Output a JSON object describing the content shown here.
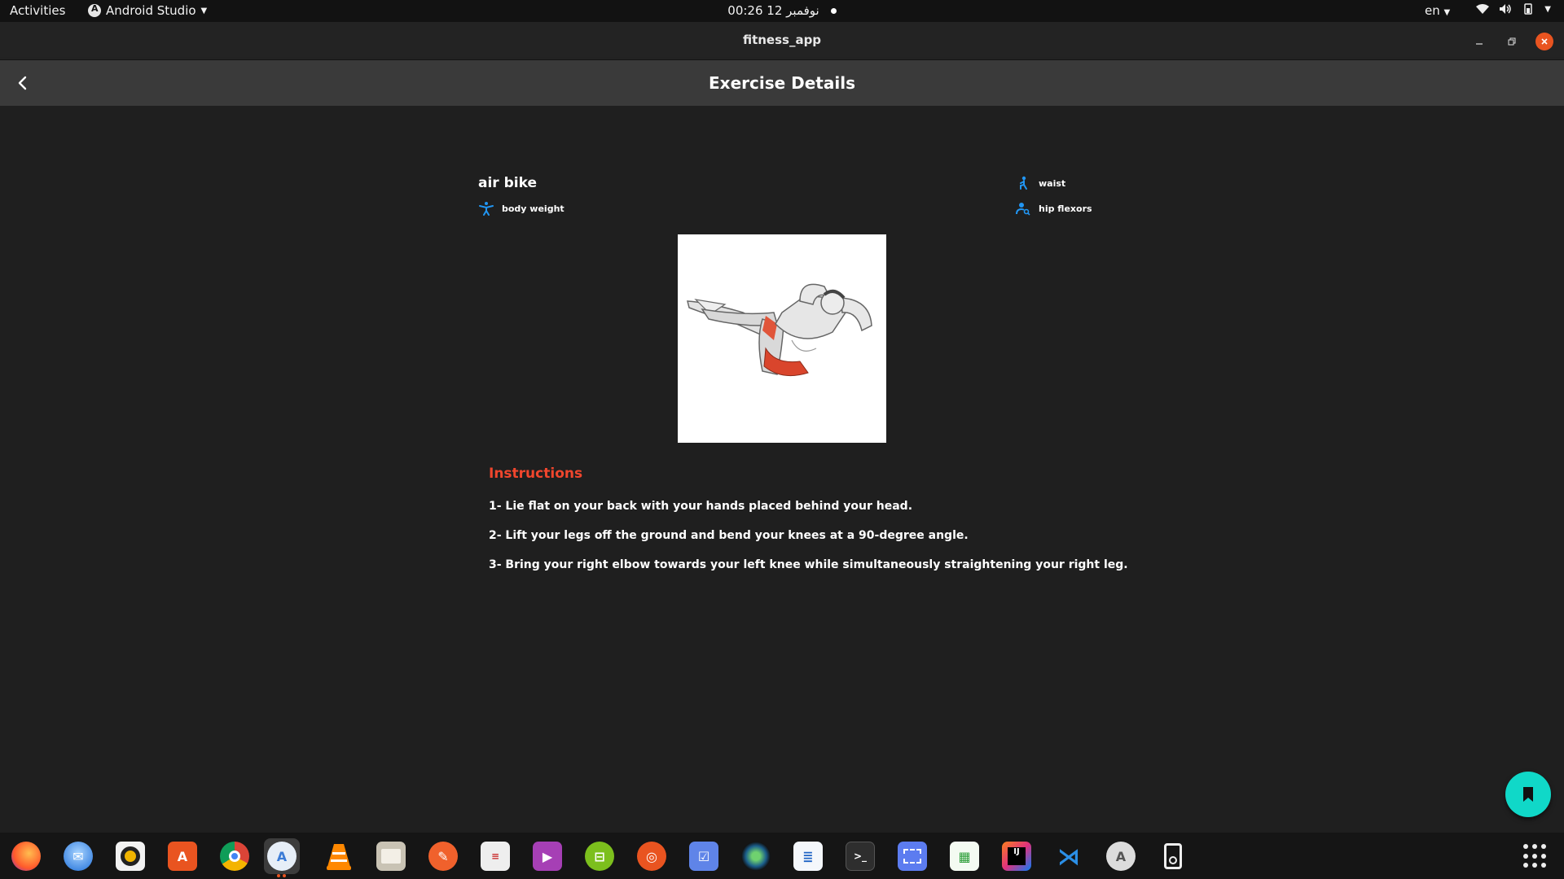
{
  "topbar": {
    "activities": "Activities",
    "app_name": "Android Studio",
    "clock": "00:26  12 نوفمبر",
    "language": "en"
  },
  "window": {
    "title": "fitness_app"
  },
  "appbar": {
    "title": "Exercise Details"
  },
  "exercise": {
    "name": "air bike",
    "equipment": "body weight",
    "body_part": "waist",
    "target": "hip flexors"
  },
  "instructions": {
    "heading": "Instructions",
    "steps": [
      "1- Lie flat on your back with your hands placed behind your head.",
      "2- Lift your legs off the ground and bend your knees at a 90-degree angle.",
      "3- Bring your right elbow towards your left knee while simultaneously straightening your right leg."
    ]
  },
  "colors": {
    "accent_red": "#f0462d",
    "fab": "#10d8c8",
    "icon_blue": "#2196f3",
    "ubuntu_orange": "#e95420"
  },
  "dock": {
    "apps": [
      "firefox-icon",
      "thunderbird-icon",
      "rhythmbox-icon",
      "software-store-icon",
      "chrome-icon",
      "android-studio-icon",
      "vlc-icon",
      "files-icon",
      "inkscape-icon",
      "document-viewer-icon",
      "video-player-icon",
      "system-monitor-icon",
      "ubuntu-icon",
      "tasks-icon",
      "camera-icon",
      "writer-icon",
      "terminal-icon",
      "screenshot-icon",
      "calc-icon",
      "intellij-icon",
      "vscode-icon",
      "software-updater-icon",
      "ipod-icon"
    ]
  }
}
